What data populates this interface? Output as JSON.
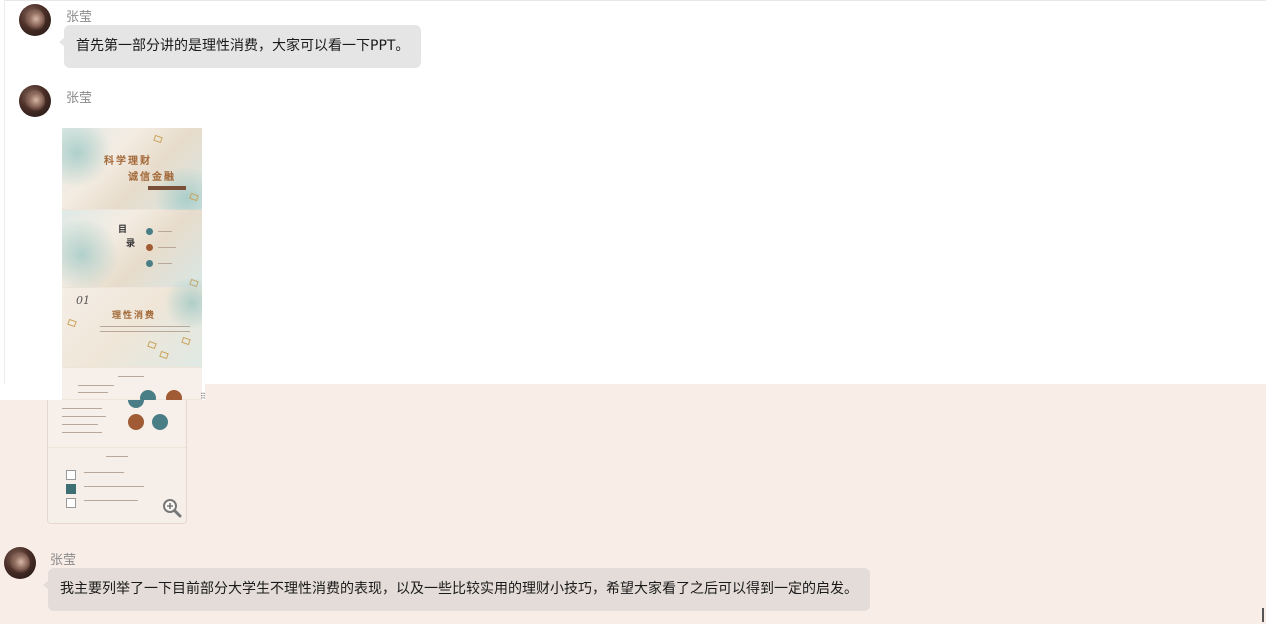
{
  "messages": [
    {
      "sender": "张莹",
      "text": "首先第一部分讲的是理性消费，大家可以看一下PPT。"
    },
    {
      "sender": "张莹",
      "type": "image"
    },
    {
      "sender": "张莹",
      "text": "我主要列举了一下目前部分大学生不理性消费的表现，以及一些比较实用的理财小技巧，希望大家看了之后可以得到一定的启发。"
    }
  ],
  "ppt": {
    "slide1_line1": "科学理财",
    "slide1_line2": "诚信金融",
    "slide2_mu": "目",
    "slide2_lu": "录",
    "slide3_num": "01",
    "slide3_title": "理性消费"
  },
  "icons": {
    "avatar": "avatar-image",
    "zoom": "zoom-in-icon"
  },
  "colors": {
    "bubble": "#e5e5e5",
    "pink_bubble": "#e3dcd8",
    "pink_background": "#f9ede8"
  }
}
